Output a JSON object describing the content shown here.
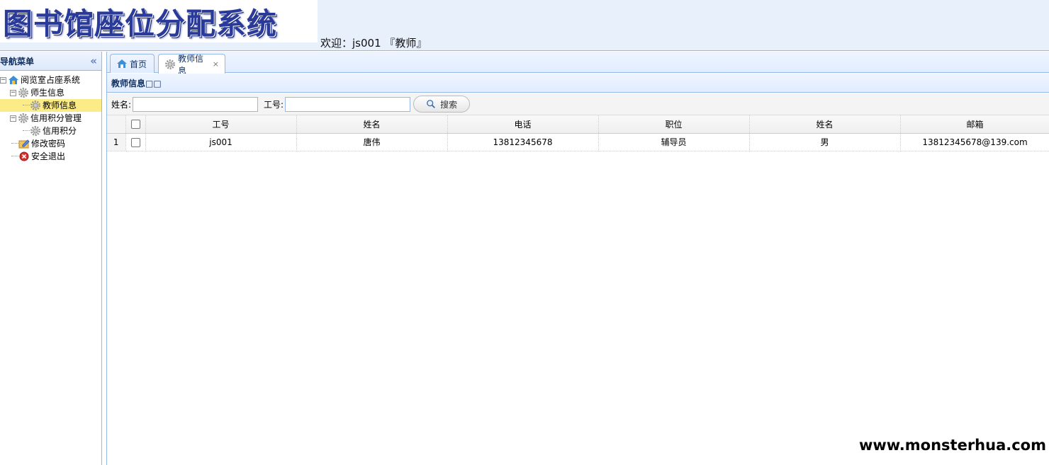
{
  "header": {
    "logo_text": "图书馆座位分配系统",
    "welcome": "欢迎：js001 『教师』"
  },
  "sidebar": {
    "title": "导航菜单",
    "collapse_icon": "double-chevron-left-icon",
    "tree": {
      "root": "阅览室占座系统",
      "teacher_student": "师生信息",
      "teacher_info": "教师信息",
      "credit_mgmt": "信用积分管理",
      "credit_points": "信用积分",
      "change_password": "修改密码",
      "logout": "安全退出"
    }
  },
  "tabs": [
    {
      "label": "首页",
      "icon": "home-icon"
    },
    {
      "label": "教师信息",
      "icon": "gear-icon",
      "close": "×"
    }
  ],
  "panel": {
    "title": "教师信息□□"
  },
  "toolbar": {
    "name_label": "姓名:",
    "name_value": "",
    "id_label": "工号:",
    "id_value": "",
    "search_label": "搜索"
  },
  "grid": {
    "columns": [
      "工号",
      "姓名",
      "电话",
      "职位",
      "姓名",
      "邮箱"
    ],
    "rows": [
      {
        "num": "1",
        "id": "js001",
        "name": "唐伟",
        "phone": "13812345678",
        "position": "辅导员",
        "gender": "男",
        "email": "13812345678@139.com"
      }
    ]
  },
  "watermark": "www.monsterhua.com",
  "colors": {
    "header_bg": "#e8f0fc",
    "border": "#95b8e7",
    "selected": "#fbec88",
    "logo_text": "#2a3a9a"
  }
}
